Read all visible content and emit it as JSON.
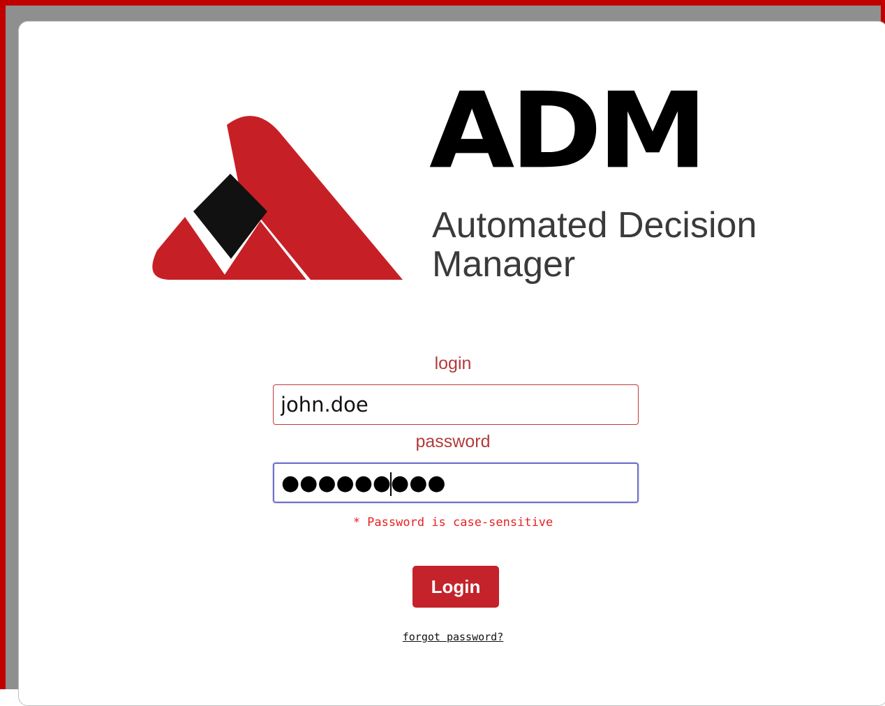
{
  "brand": {
    "wordmark": "ADM",
    "subtitle": "Automated Decision Manager",
    "colors": {
      "primary": "#c4232b",
      "frame": "#c00000",
      "dark": "#111111"
    }
  },
  "form": {
    "login_label": "login",
    "login_value": "john.doe",
    "password_label": "password",
    "password_masked": "●●●●●●●●●",
    "password_hint": "* Password is case-sensitive",
    "submit_label": "Login",
    "forgot_link": "forgot password?"
  }
}
